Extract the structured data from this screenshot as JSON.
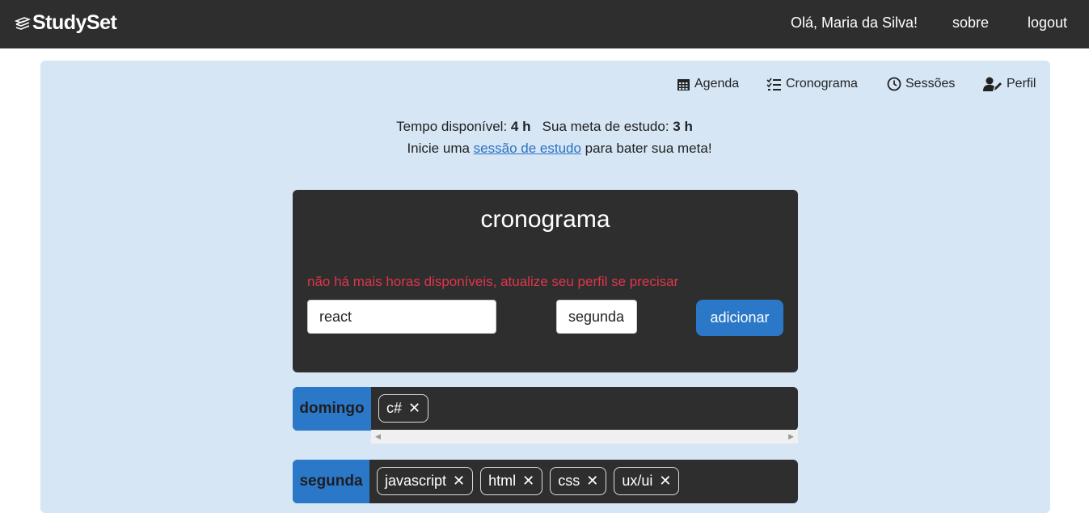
{
  "header": {
    "brand": "StudySet",
    "greeting": "Olá, Maria da Silva!",
    "about": "sobre",
    "logout": "logout"
  },
  "subnav": {
    "agenda": "Agenda",
    "cronograma": "Cronograma",
    "sessoes": "Sessões",
    "perfil": "Perfil"
  },
  "info": {
    "available_label": "Tempo disponível:",
    "available_value": "4 h",
    "goal_label": "Sua meta de estudo:",
    "goal_value": "3 h",
    "prompt_before": "Inicie uma",
    "prompt_link": "sessão de estudo",
    "prompt_after": "para bater sua meta!"
  },
  "card": {
    "title": "cronograma",
    "warning": "não há mais horas disponíveis, atualize seu perfil se precisar",
    "subject_value": "react",
    "day_value": "segunda",
    "add_label": "adicionar"
  },
  "days": [
    {
      "label": "domingo",
      "subjects": [
        "c#"
      ]
    },
    {
      "label": "segunda",
      "subjects": [
        "javascript",
        "html",
        "css",
        "ux/ui"
      ]
    }
  ],
  "remove_symbol": "✕",
  "colors": {
    "accent": "#2b78c9",
    "dark": "#2e2e2e",
    "panel": "#d6e6f5",
    "warning": "#e0354a"
  }
}
